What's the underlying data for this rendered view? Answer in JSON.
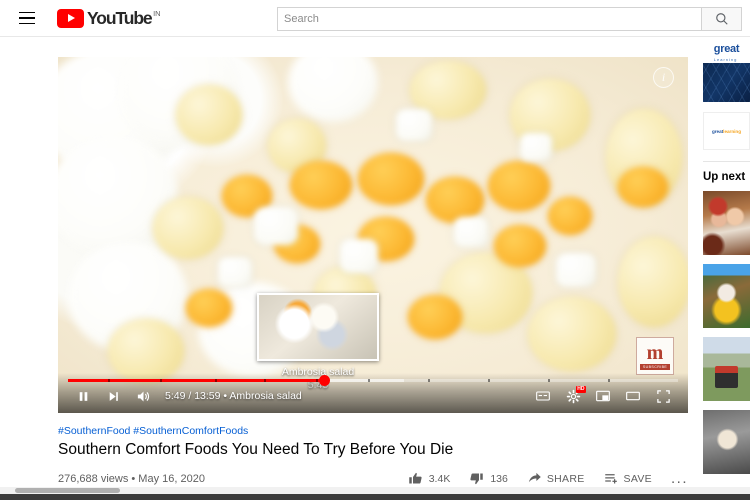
{
  "masthead": {
    "menu_icon": "hamburger-icon",
    "logo_text": "YouTube",
    "logo_country": "IN",
    "search": {
      "placeholder": "Search",
      "value": "",
      "button_icon": "search-icon"
    }
  },
  "player": {
    "info_icon": "info-icon",
    "watermark": {
      "letter": "m",
      "subscribe_label": "SUBSCRIBE"
    },
    "preview": {
      "title": "Ambrosia salad",
      "timestamp": "5:45"
    },
    "controls": {
      "play_pause_icon": "pause-icon",
      "next_icon": "next-video-icon",
      "volume_icon": "volume-icon",
      "time_display": "5:49 / 13:59 • Ambrosia salad",
      "current_time": "5:49",
      "duration": "13:59",
      "chapter_name": "Ambrosia salad",
      "progress_percent": 42,
      "buffered_percent": 55,
      "captions_icon": "closed-captions-icon",
      "settings_icon": "settings-gear-icon",
      "quality_badge": "HD",
      "miniplayer_icon": "miniplayer-icon",
      "theater_icon": "theater-mode-icon",
      "fullscreen_icon": "fullscreen-icon"
    }
  },
  "video_meta": {
    "hashtags": "#SouthernFood #SouthernComfortFoods",
    "title": "Southern Comfort Foods You Need To Try Before You Die",
    "views": "276,688 views",
    "separator": "•",
    "upload_date": "May 16, 2020",
    "views_line": "276,688 views • May 16, 2020",
    "actions": [
      {
        "name": "like",
        "icon": "thumbs-up-icon",
        "count": "3.4K",
        "label": ""
      },
      {
        "name": "dislike",
        "icon": "thumbs-down-icon",
        "count": "136",
        "label": ""
      },
      {
        "name": "share",
        "icon": "share-arrow-icon",
        "count": "",
        "label": "SHARE"
      },
      {
        "name": "save",
        "icon": "save-playlist-icon",
        "count": "",
        "label": "SAVE"
      },
      {
        "name": "more",
        "icon": "more-options-icon",
        "count": "",
        "label": "..."
      }
    ]
  },
  "sidebar": {
    "ad": {
      "brand": "great",
      "brand_sub": "Learning",
      "card_text_1": "great",
      "card_text_2": "learning"
    },
    "up_next_label": "Up next",
    "thumbnails": [
      {
        "name": "suggested-video-1"
      },
      {
        "name": "suggested-video-2"
      },
      {
        "name": "suggested-video-3"
      },
      {
        "name": "suggested-video-4"
      }
    ]
  },
  "colors": {
    "brand_red": "#ff0000",
    "link_blue": "#065fd4",
    "text_primary": "#030303",
    "text_secondary": "#606060"
  }
}
